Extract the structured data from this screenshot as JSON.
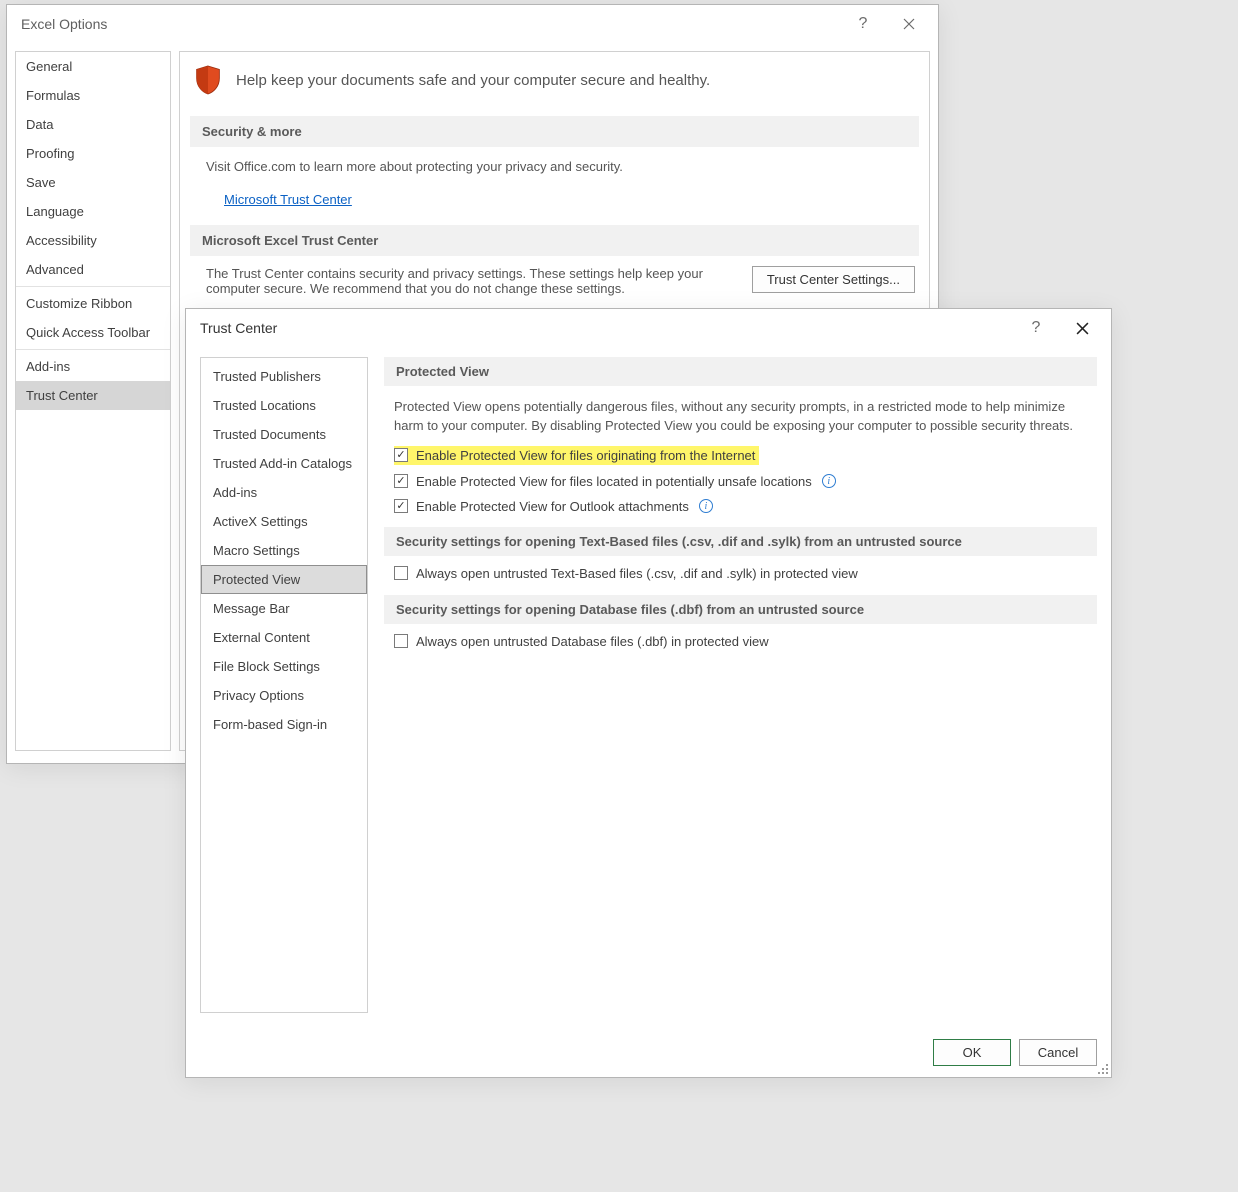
{
  "optionsWindow": {
    "title": "Excel Options",
    "sidebar": [
      "General",
      "Formulas",
      "Data",
      "Proofing",
      "Save",
      "Language",
      "Accessibility",
      "Advanced",
      "__sep__",
      "Customize Ribbon",
      "Quick Access Toolbar",
      "__sep__",
      "Add-ins",
      "Trust Center"
    ],
    "selected": "Trust Center",
    "banner": "Help keep your documents safe and your computer secure and healthy.",
    "sec1": {
      "title": "Security & more",
      "body": "Visit Office.com to learn more about protecting your privacy and security.",
      "link": "Microsoft Trust Center"
    },
    "sec2": {
      "title": "Microsoft Excel Trust Center",
      "body": "The Trust Center contains security and privacy settings. These settings help keep your computer secure. We recommend that you do not change these settings.",
      "button": "Trust Center Settings..."
    }
  },
  "trustCenterWindow": {
    "title": "Trust Center",
    "sidebar": [
      "Trusted Publishers",
      "Trusted Locations",
      "Trusted Documents",
      "Trusted Add-in Catalogs",
      "Add-ins",
      "ActiveX Settings",
      "Macro Settings",
      "Protected View",
      "Message Bar",
      "External Content",
      "File Block Settings",
      "Privacy Options",
      "Form-based Sign-in"
    ],
    "selected": "Protected View",
    "page": {
      "head1": "Protected View",
      "desc": "Protected View opens potentially dangerous files, without any security prompts, in a restricted mode to help minimize harm to your computer. By disabling Protected View you could be exposing your computer to possible security threats.",
      "chk1": {
        "checked": true,
        "label": "Enable Protected View for files originating from the Internet",
        "highlight": true
      },
      "chk2": {
        "checked": true,
        "label": "Enable Protected View for files located in potentially unsafe locations",
        "info": true
      },
      "chk3": {
        "checked": true,
        "label": "Enable Protected View for Outlook attachments",
        "info": true
      },
      "head2": "Security settings for opening Text-Based files (.csv, .dif and .sylk) from an untrusted source",
      "chk4": {
        "checked": false,
        "label": "Always open untrusted Text-Based files (.csv, .dif and .sylk) in protected view"
      },
      "head3": "Security settings for opening Database files (.dbf) from an untrusted source",
      "chk5": {
        "checked": false,
        "label": "Always open untrusted Database files (.dbf) in protected view"
      }
    },
    "footer": {
      "ok": "OK",
      "cancel": "Cancel"
    }
  }
}
